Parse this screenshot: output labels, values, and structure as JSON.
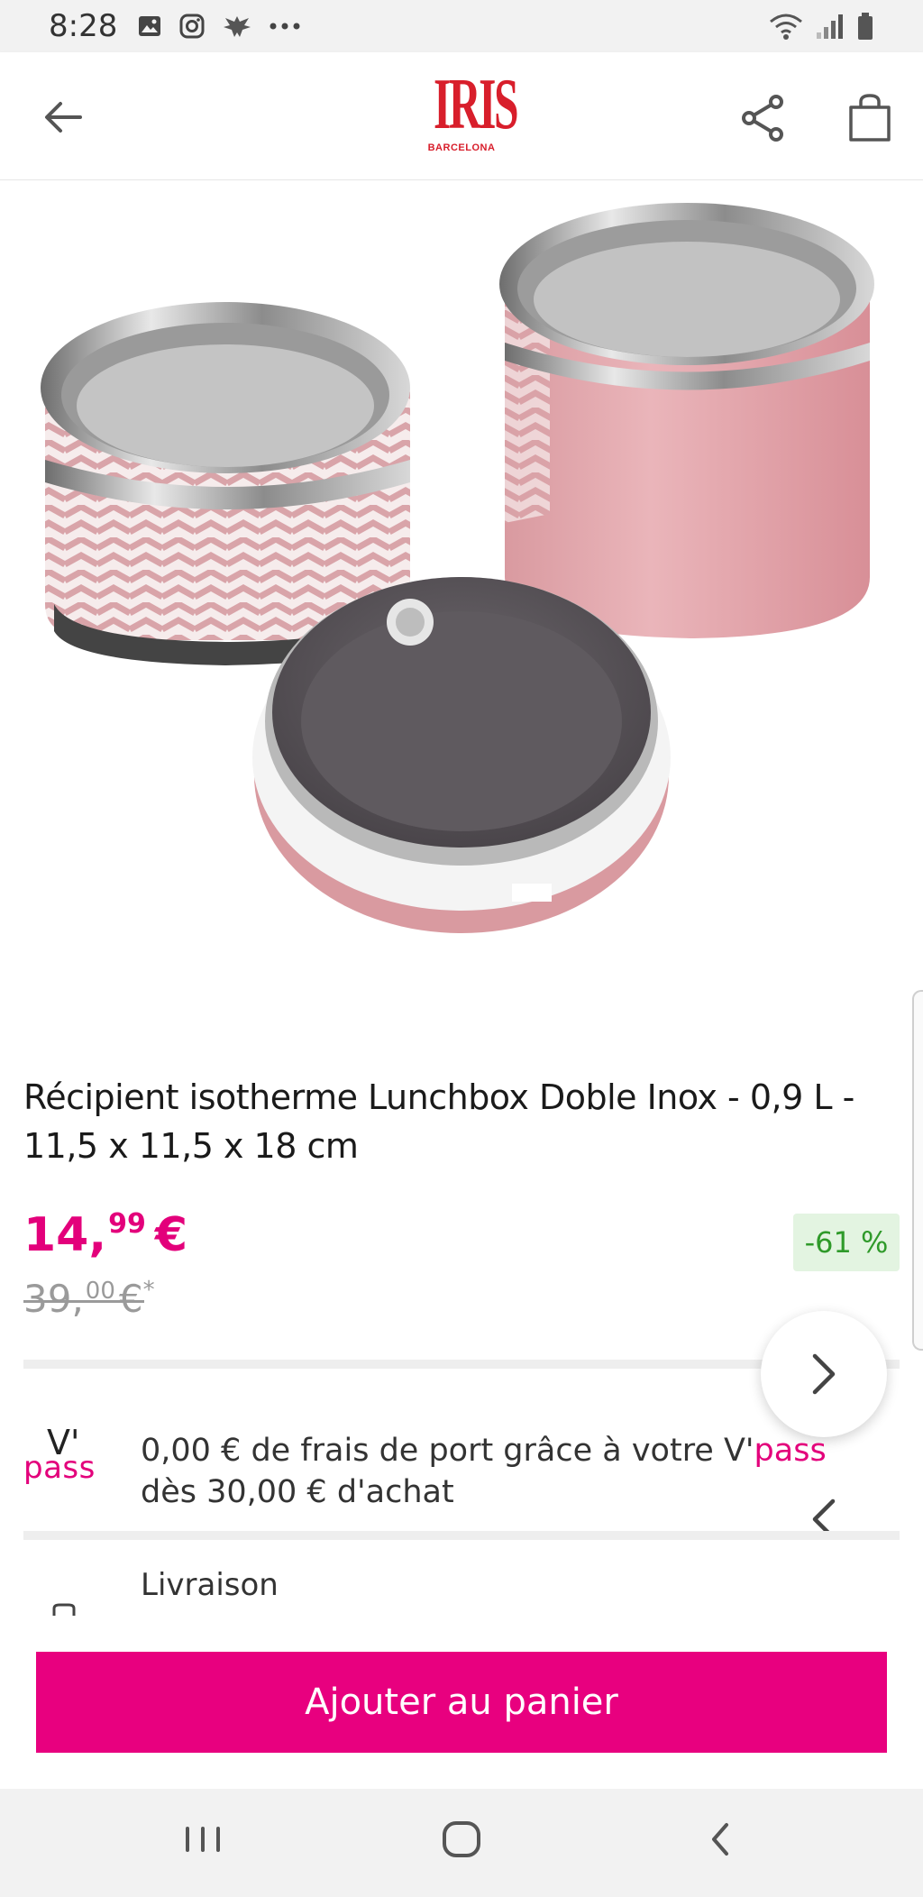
{
  "status_bar": {
    "time": "8:28"
  },
  "header": {
    "logo_text": "IRIS",
    "logo_subtext": "BARCELONA"
  },
  "product": {
    "title": "Récipient isotherme Lunchbox Doble Inox - 0,9 L - 11,5 x 11,5 x 18 cm",
    "price_int": "14,",
    "price_dec": "99",
    "price_currency": "€",
    "old_price_int": "39,",
    "old_price_dec": "00",
    "old_price_currency": "€",
    "old_price_asterisk": "*",
    "discount": "-61 %"
  },
  "vpass": {
    "logo_top": "V'",
    "logo_bottom": "pass",
    "text_before": "0,00 € de frais de port grâce à votre V'",
    "text_pass": "pass",
    "text_after": " dès 30,00 € d'achat"
  },
  "delivery": {
    "label": "Livraison"
  },
  "actions": {
    "add_to_cart": "Ajouter au panier"
  },
  "colors": {
    "accent": "#e8007f",
    "discount_bg": "#e3f4e1",
    "discount_text": "#2f9a2a",
    "logo_red": "#d81e2b"
  },
  "icons": {
    "back": "arrow-left-icon",
    "share": "share-icon",
    "cart": "shopping-bag-icon",
    "next": "chevron-right-icon",
    "prev": "chevron-left-icon"
  }
}
